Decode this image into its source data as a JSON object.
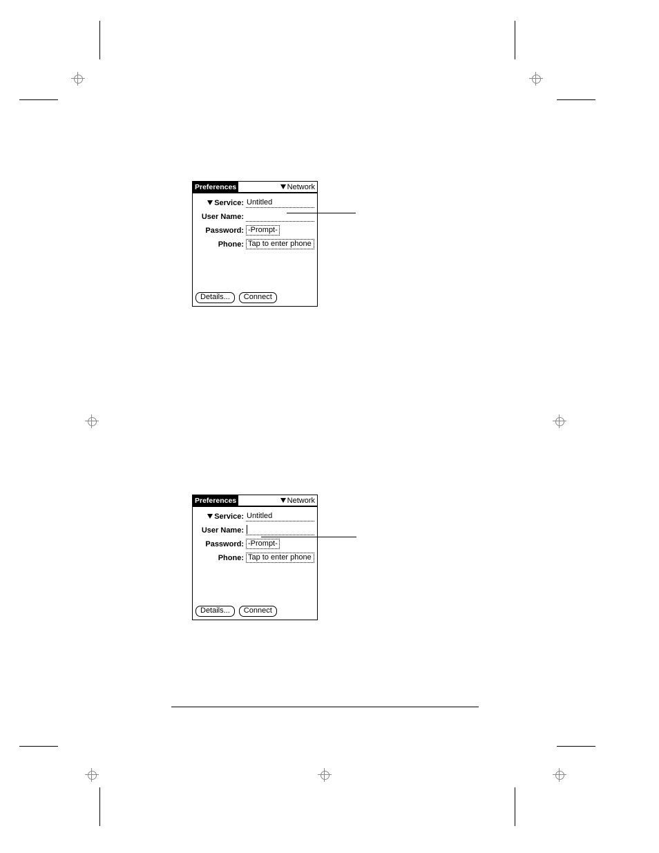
{
  "panel": {
    "title": "Preferences",
    "category": "Network",
    "labels": {
      "service": "Service:",
      "username": "User Name:",
      "password": "Password:",
      "phone": "Phone:"
    },
    "values": {
      "service": "Untitled",
      "username": "",
      "password": "-Prompt-",
      "phone": "Tap to enter phone"
    },
    "buttons": {
      "details": "Details...",
      "connect": "Connect"
    }
  }
}
